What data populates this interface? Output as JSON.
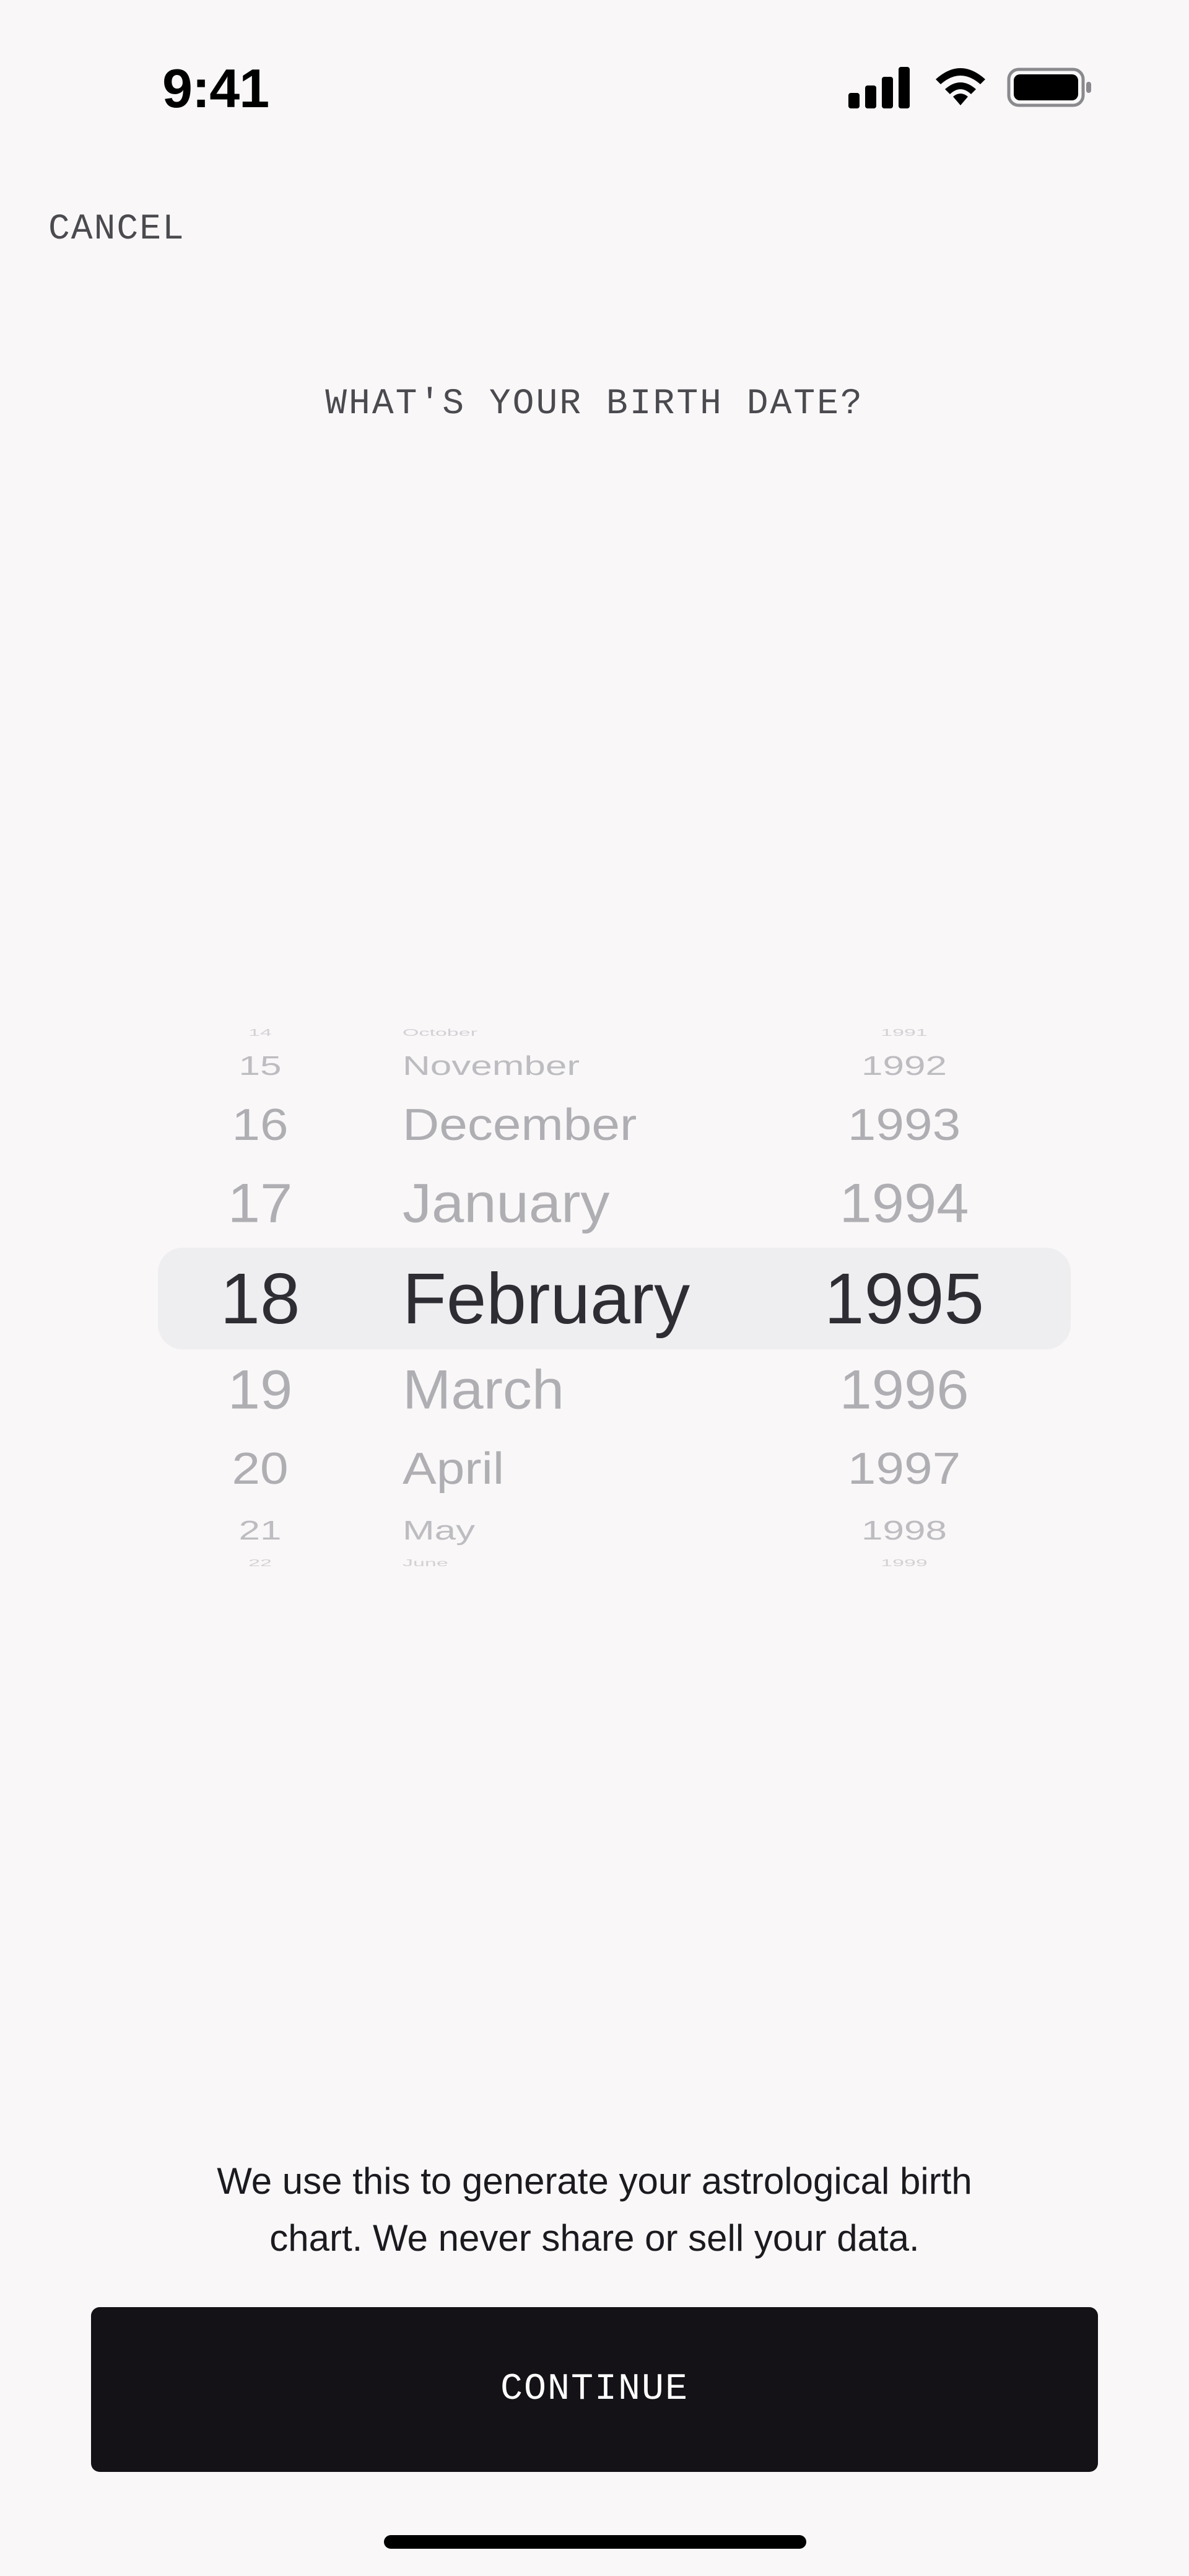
{
  "status_bar": {
    "time": "9:41",
    "icons": [
      "cellular-signal-icon",
      "wifi-icon",
      "battery-icon"
    ]
  },
  "header": {
    "cancel_label": "CANCEL",
    "question": "WHAT'S YOUR BIRTH DATE?"
  },
  "picker": {
    "days": [
      "14",
      "15",
      "16",
      "17",
      "18",
      "19",
      "20",
      "21",
      "22"
    ],
    "months": [
      "October",
      "November",
      "December",
      "January",
      "February",
      "March",
      "April",
      "May",
      "June"
    ],
    "years": [
      "1991",
      "1992",
      "1993",
      "1994",
      "1995",
      "1996",
      "1997",
      "1998",
      "1999"
    ],
    "selected": {
      "day": "18",
      "month": "February",
      "year": "1995"
    }
  },
  "footer": {
    "note_line1": "We use this to generate your astrological birth",
    "note_line2": "chart. We never share or sell your data.",
    "continue_label": "CONTINUE"
  },
  "colors": {
    "background": "#F9F7F8",
    "button": "#141216",
    "selected_text": "#2E2D33",
    "muted_text": "#AFAEB2"
  }
}
